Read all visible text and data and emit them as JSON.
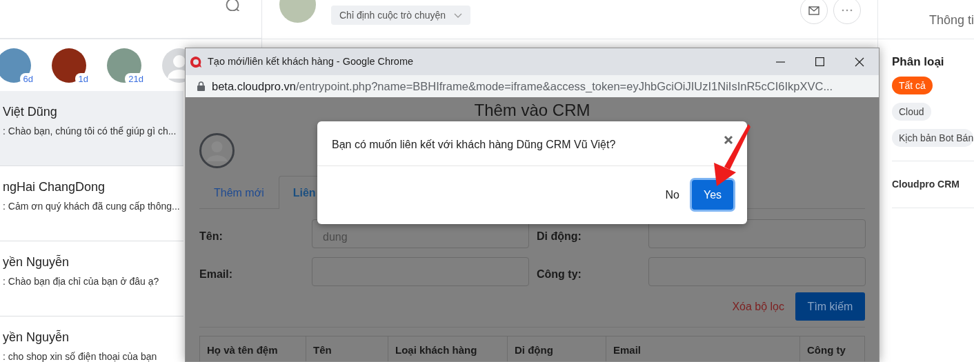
{
  "left_panel": {
    "stories": [
      {
        "kind": "photo",
        "color": "#5c8fb8",
        "badge": "6d"
      },
      {
        "kind": "photo",
        "color": "#8c2a14",
        "badge": "1d"
      },
      {
        "kind": "photo",
        "color": "#7f9a8c",
        "badge": "21d"
      },
      {
        "kind": "default"
      }
    ],
    "conversations": [
      {
        "name": "Việt Dũng",
        "preview": ": Chào bạn, chúng tôi có thể giúp gì ch...",
        "selected": true
      },
      {
        "name": "ngHai ChangDong",
        "preview": ": Cảm ơn quý khách đã cung cấp thông...",
        "selected": false
      },
      {
        "name": "yền Nguyễn",
        "preview": ": Chào bạn địa chỉ của bạn ở đâu ạ?",
        "selected": false
      },
      {
        "name": "yền Nguyễn",
        "preview": ": cho shop xin số điện thoại của bạn",
        "selected": false
      }
    ]
  },
  "chat_header": {
    "assign_dropdown": "Chỉ định cuộc trò chuyện"
  },
  "right_panel": {
    "header": "Thông ti",
    "section_title": "Phân loại",
    "tags": [
      {
        "label": "Tất cả",
        "selected": true
      },
      {
        "label": "Cloud",
        "selected": false
      },
      {
        "label": "Kịch bản Bot Bán",
        "selected": false
      }
    ],
    "account": "Cloudpro CRM"
  },
  "popup_window": {
    "title": "Tạo mới/liên kết khách hàng - Google Chrome",
    "url_host": "beta.cloudpro.vn",
    "url_path": "/entrypoint.php?name=BBHIframe&mode=iframe&access_token=eyJhbGciOiJIUzI1NiIsInR5cCI6IkpXVC...",
    "page_title": "Thêm vào CRM",
    "tabs": [
      {
        "label": "Thêm mới",
        "selected": false
      },
      {
        "label": "Liên",
        "selected": true
      }
    ],
    "fields": [
      {
        "label": "Tên:",
        "value": "dung"
      },
      {
        "label": "Di động:"
      },
      {
        "label": "Email:"
      },
      {
        "label": "Công ty:"
      }
    ],
    "clear_link": "Xóa bộ lọc",
    "search_button": "Tìm kiếm",
    "table": {
      "columns": [
        "Họ và tên đệm",
        "Tên",
        "Loại khách hàng",
        "Di động",
        "Email",
        "Công ty"
      ]
    }
  },
  "confirm_dialog": {
    "message": "Bạn có muốn liên kết với khách hàng Dũng CRM Vũ Việt?",
    "buttons": [
      {
        "label": "No",
        "kind": "secondary"
      },
      {
        "label": "Yes",
        "kind": "primary"
      }
    ]
  }
}
